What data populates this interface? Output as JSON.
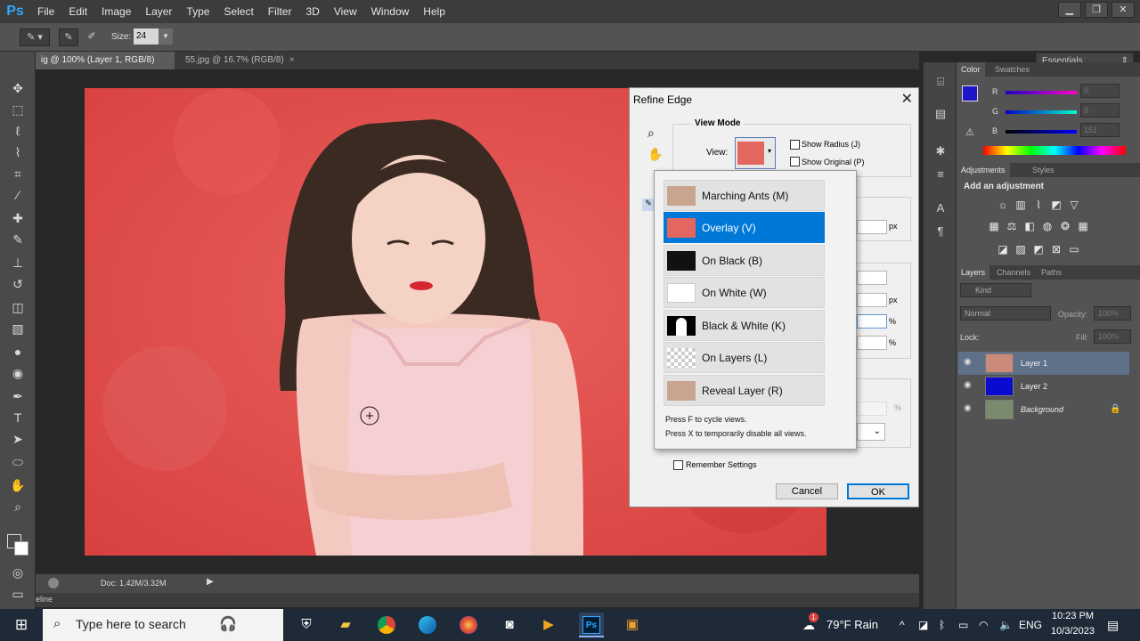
{
  "app": {
    "logo": "Ps",
    "menu": [
      "File",
      "Edit",
      "Image",
      "Layer",
      "Type",
      "Select",
      "Filter",
      "3D",
      "View",
      "Window",
      "Help"
    ],
    "window_buttons": [
      "▁",
      "❐",
      "✕"
    ]
  },
  "options": {
    "size_label": "Size:",
    "size_value": "24",
    "workspace": "Essentials"
  },
  "tabs": [
    {
      "label": "ig @ 100% (Layer 1, RGB/8) *",
      "close": "×"
    },
    {
      "label": "55.jpg @ 16.7% (RGB/8)",
      "close": "×"
    }
  ],
  "status": {
    "doc": "Doc: 1.42M/3.32M",
    "timeline": "eline"
  },
  "color_panel": {
    "tabs": [
      "Color",
      "Swatches"
    ],
    "channels": [
      {
        "name": "R",
        "value": "0"
      },
      {
        "name": "G",
        "value": "9"
      },
      {
        "name": "B",
        "value": "151"
      }
    ],
    "foreground": "#1d17c8"
  },
  "adjustments": {
    "tabs": [
      "Adjustments",
      "Styles"
    ],
    "title": "Add an adjustment"
  },
  "layers_panel": {
    "tabs": [
      "Layers",
      "Channels",
      "Paths"
    ],
    "kind": "Kind",
    "blend_mode": "Normal",
    "opacity_label": "Opacity:",
    "opacity_value": "100%",
    "lock_label": "Lock:",
    "fill_label": "Fill:",
    "fill_value": "100%",
    "layers": [
      {
        "name": "Layer 1",
        "italic": false,
        "selected": true
      },
      {
        "name": "Layer 2",
        "italic": false,
        "selected": false
      },
      {
        "name": "Background",
        "italic": true,
        "selected": false
      }
    ]
  },
  "refine_edge": {
    "title": "Refine Edge",
    "view_mode_label": "View Mode",
    "view_label": "View:",
    "show_radius": "Show Radius (J)",
    "show_original": "Show Original (P)",
    "unit_px": "px",
    "unit_pct": "%",
    "remember": "Remember Settings",
    "cancel": "Cancel",
    "ok": "OK",
    "view_options": [
      {
        "label": "Marching Ants (M)",
        "selected": false
      },
      {
        "label": "Overlay (V)",
        "selected": true
      },
      {
        "label": "On Black (B)",
        "selected": false
      },
      {
        "label": "On White (W)",
        "selected": false
      },
      {
        "label": "Black & White (K)",
        "selected": false
      },
      {
        "label": "On Layers (L)",
        "selected": false
      },
      {
        "label": "Reveal Layer (R)",
        "selected": false
      }
    ],
    "hint1": "Press F to cycle views.",
    "hint2": "Press X to temporarily disable all views."
  },
  "taskbar": {
    "search_placeholder": "Type here to search",
    "weather": "79°F  Rain",
    "language": "ENG",
    "time": "10:23 PM",
    "date": "10/3/2023",
    "badge": "1"
  }
}
